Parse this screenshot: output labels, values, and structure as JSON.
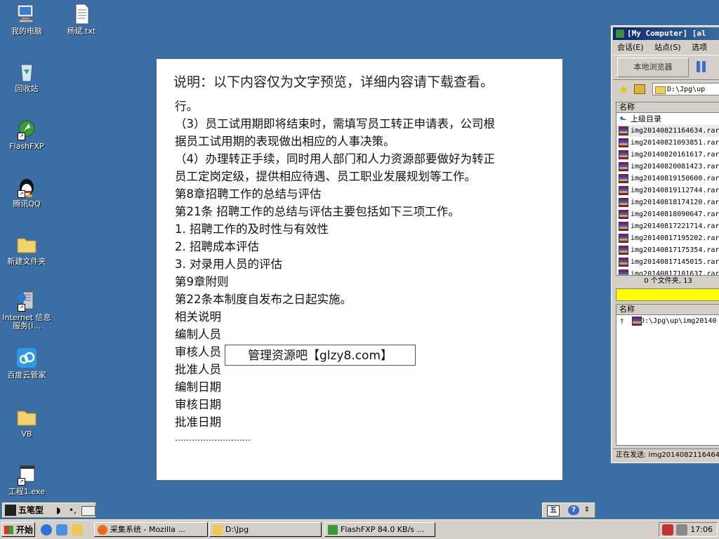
{
  "desktop": {
    "icons": [
      {
        "label": "我的电脑"
      },
      {
        "label": "杨斌.txt"
      },
      {
        "label": "回收站"
      },
      {
        "label": "FlashFXP"
      },
      {
        "label": "腾讯QQ"
      },
      {
        "label": "新建文件夹"
      },
      {
        "label": "Internet 信息服务(I..."
      },
      {
        "label": "百度云管家"
      },
      {
        "label": "VB"
      },
      {
        "label": "工程1.exe"
      }
    ]
  },
  "document": {
    "title": "说明：以下内容仅为文字预览，详细内容请下载查看。",
    "lines": [
      "行。",
      "（3）员工试用期即将结束时，需填写员工转正申请表，公司根",
      "据员工试用期的表现做出相应的人事决策。",
      "（4）办理转正手续，同时用人部门和人力资源部要做好为转正",
      "员工定岗定级，提供相应待遇、员工职业发展规划等工作。",
      "第8章招聘工作的总结与评估",
      "第21条 招聘工作的总结与评估主要包括如下三项工作。",
      "1. 招聘工作的及时性与有效性",
      "2. 招聘成本评估",
      "3. 对录用人员的评估",
      "第9章附则",
      "第22条本制度自发布之日起实施。",
      "相关说明",
      "编制人员",
      "审核人员",
      "批准人员",
      "编制日期",
      "审核日期",
      "批准日期",
      "………………………"
    ],
    "stamp": "管理资源吧【glzy8.com】"
  },
  "flashfxp": {
    "title": "[My Computer]  [al",
    "menu": [
      "会话(E)",
      "站点(S)",
      "选项"
    ],
    "local_browser": "本地浏览器",
    "path": "D:\\Jpg\\up",
    "list_header": "名称",
    "parent_dir": "上级目录",
    "files": [
      "img20140821164634.rar",
      "img20140821093851.rar",
      "img20140820161617.rar",
      "img20140820081423.rar",
      "img20140819150600.rar",
      "img20140819112744.rar",
      "img20140818174120.rar",
      "img20140818090647.rar",
      "img20140817221714.rar",
      "img20140817195202.rar",
      "img20140817175354.rar",
      "img20140817145015.rar",
      "img20140817101637.rar"
    ],
    "status": "0 个文件夹, 13",
    "queue_header": "名称",
    "queue_item": "D:\\Jpg\\up\\img20140",
    "sending": "正在发送: img2014082116464"
  },
  "ime": {
    "mode": "五笔型"
  },
  "taskbar": {
    "start": "开始",
    "tasks": [
      {
        "label": "采集系统 - Mozilla ..."
      },
      {
        "label": "D:\\Jpg"
      },
      {
        "label": "FlashFXP 84.0 KB/s ..."
      }
    ],
    "clock": "17:06"
  }
}
